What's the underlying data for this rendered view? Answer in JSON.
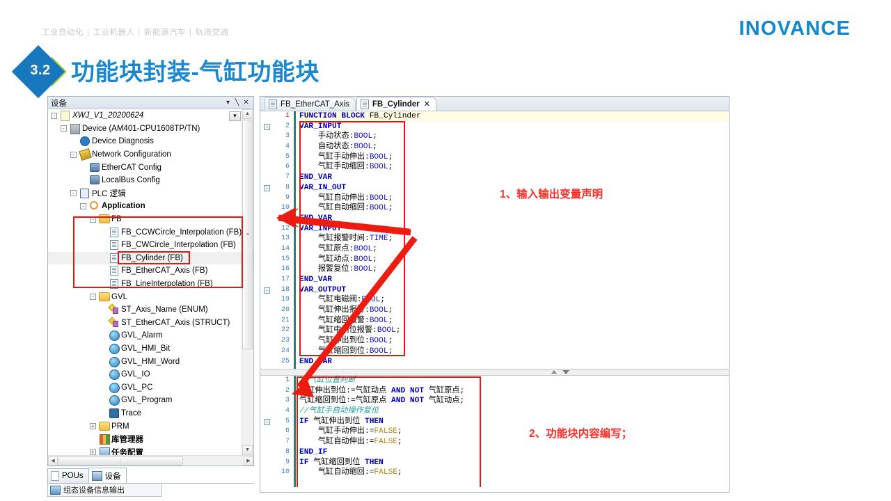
{
  "header": {
    "logo": "INOVANCE",
    "breadcrumb": [
      "工业自动化",
      "工业机器人",
      "新能源汽车",
      "轨道交通"
    ],
    "separator": "|"
  },
  "title": {
    "section_number": "3.2",
    "text": "功能块封装-气缸功能块"
  },
  "colors": {
    "brand_blue": "#1289CA",
    "title_blue": "#1B87CF",
    "diamond_blue": "#1878BE",
    "chevron_green": "#A5CE39",
    "annotation_red": "#ff2d26",
    "highlight_red": "#e8140f",
    "keyword_blue": "#0000C0",
    "comment_teal": "#1f9c9c",
    "literal_gold": "#b8860b"
  },
  "device_panel": {
    "title": "设备",
    "header_buttons": [
      "▾",
      "⇱",
      "✕"
    ],
    "dropdown_button": "▼",
    "tree": [
      {
        "indent": 1,
        "expander": "-",
        "icon": "project-icon",
        "label": "XWJ_V1_20200624",
        "style": "italic"
      },
      {
        "indent": 2,
        "expander": "-",
        "icon": "device-icon",
        "label": "Device (AM401-CPU1608TP/TN)",
        "style": "normal"
      },
      {
        "indent": 3,
        "expander": "",
        "icon": "diagnosis-icon",
        "label": "Device Diagnosis",
        "style": "normal"
      },
      {
        "indent": 3,
        "expander": "-",
        "icon": "network-icon",
        "label": "Network Configuration",
        "style": "normal"
      },
      {
        "indent": 4,
        "expander": "",
        "icon": "config-icon",
        "label": "EtherCAT Config",
        "style": "normal"
      },
      {
        "indent": 4,
        "expander": "",
        "icon": "config-icon",
        "label": "LocalBus Config",
        "style": "normal"
      },
      {
        "indent": 3,
        "expander": "-",
        "icon": "plc-icon",
        "label": "PLC 逻辑",
        "style": "normal"
      },
      {
        "indent": 4,
        "expander": "-",
        "icon": "application-icon",
        "label": "Application",
        "style": "bold"
      },
      {
        "indent": 5,
        "expander": "-",
        "icon": "folder-icon",
        "label": "FB",
        "style": "normal"
      },
      {
        "indent": 6,
        "expander": "",
        "icon": "fb-icon",
        "label": "FB_CCWCircle_Interpolation (FB)",
        "style": "normal"
      },
      {
        "indent": 6,
        "expander": "",
        "icon": "fb-icon",
        "label": "FB_CWCircle_Interpolation (FB)",
        "style": "normal"
      },
      {
        "indent": 6,
        "expander": "",
        "icon": "fb-icon",
        "label": "FB_Cylinder (FB)",
        "style": "normal",
        "selected": true
      },
      {
        "indent": 6,
        "expander": "",
        "icon": "fb-icon",
        "label": "FB_EtherCAT_Axis (FB)",
        "style": "normal"
      },
      {
        "indent": 6,
        "expander": "",
        "icon": "fb-icon",
        "label": "FB_LineInterpolation (FB)",
        "style": "normal"
      },
      {
        "indent": 5,
        "expander": "-",
        "icon": "folder-icon",
        "label": "GVL",
        "style": "normal"
      },
      {
        "indent": 6,
        "expander": "",
        "icon": "enum-icon",
        "label": "ST_Axis_Name (ENUM)",
        "style": "normal"
      },
      {
        "indent": 6,
        "expander": "",
        "icon": "enum-icon",
        "label": "ST_EtherCAT_Axis (STRUCT)",
        "style": "normal"
      },
      {
        "indent": 6,
        "expander": "",
        "icon": "gvl-icon",
        "label": "GVL_Alarm",
        "style": "normal"
      },
      {
        "indent": 6,
        "expander": "",
        "icon": "gvl-icon",
        "label": "GVL_HMI_Bit",
        "style": "normal"
      },
      {
        "indent": 6,
        "expander": "",
        "icon": "gvl-icon",
        "label": "GVL_HMI_Word",
        "style": "normal"
      },
      {
        "indent": 6,
        "expander": "",
        "icon": "gvl-icon",
        "label": "GVL_IO",
        "style": "normal"
      },
      {
        "indent": 6,
        "expander": "",
        "icon": "gvl-icon",
        "label": "GVL_PC",
        "style": "normal"
      },
      {
        "indent": 6,
        "expander": "",
        "icon": "gvl-icon",
        "label": "GVL_Program",
        "style": "normal"
      },
      {
        "indent": 6,
        "expander": "",
        "icon": "trace-icon",
        "label": "Trace",
        "style": "normal"
      },
      {
        "indent": 5,
        "expander": "+",
        "icon": "folder-icon",
        "label": "PRM",
        "style": "normal"
      },
      {
        "indent": 5,
        "expander": "",
        "icon": "library-icon",
        "label": "库管理器",
        "style": "bold"
      },
      {
        "indent": 5,
        "expander": "+",
        "icon": "task-icon",
        "label": "任务配置",
        "style": "bold"
      }
    ],
    "tabs": [
      {
        "label": "POUs",
        "icon": "pou-icon",
        "active": false
      },
      {
        "label": "设备",
        "icon": "device-tab-icon",
        "active": true
      }
    ],
    "footer_label": "组态设备信息输出"
  },
  "editor": {
    "tabs": [
      {
        "label": "FB_EtherCAT_Axis",
        "active": false,
        "closable": false
      },
      {
        "label": "FB_Cylinder",
        "active": true,
        "closable": true,
        "close_glyph": "✕"
      }
    ],
    "declaration": {
      "lines": [
        {
          "n": 1,
          "fold": "",
          "highlight": true,
          "tokens": [
            {
              "t": "FUNCTION BLOCK ",
              "c": "kw"
            },
            {
              "t": "FB_Cylinder",
              "c": ""
            }
          ]
        },
        {
          "n": 2,
          "fold": "-",
          "tokens": [
            {
              "t": "VAR_INPUT",
              "c": "kw"
            }
          ]
        },
        {
          "n": 3,
          "fold": "",
          "tokens": [
            {
              "t": "    手动状态:",
              "c": ""
            },
            {
              "t": "BOOL",
              "c": "ty"
            },
            {
              "t": ";",
              "c": ""
            }
          ]
        },
        {
          "n": 4,
          "fold": "",
          "tokens": [
            {
              "t": "    自动状态:",
              "c": ""
            },
            {
              "t": "BOOL",
              "c": "ty"
            },
            {
              "t": ";",
              "c": ""
            }
          ]
        },
        {
          "n": 5,
          "fold": "",
          "tokens": [
            {
              "t": "    气缸手动伸出:",
              "c": ""
            },
            {
              "t": "BOOL",
              "c": "ty"
            },
            {
              "t": ";",
              "c": ""
            }
          ]
        },
        {
          "n": 6,
          "fold": "",
          "tokens": [
            {
              "t": "    气缸手动缩回:",
              "c": ""
            },
            {
              "t": "BOOL",
              "c": "ty"
            },
            {
              "t": ";",
              "c": ""
            }
          ]
        },
        {
          "n": 7,
          "fold": "",
          "tokens": [
            {
              "t": "END_VAR",
              "c": "kw"
            }
          ]
        },
        {
          "n": 8,
          "fold": "-",
          "tokens": [
            {
              "t": "VAR_IN_OUT",
              "c": "kw"
            }
          ]
        },
        {
          "n": 9,
          "fold": "",
          "tokens": [
            {
              "t": "    气缸自动伸出:",
              "c": ""
            },
            {
              "t": "BOOL",
              "c": "ty"
            },
            {
              "t": ";",
              "c": ""
            }
          ]
        },
        {
          "n": 10,
          "fold": "",
          "tokens": [
            {
              "t": "    气缸自动缩回:",
              "c": ""
            },
            {
              "t": "BOOL",
              "c": "ty"
            },
            {
              "t": ";",
              "c": ""
            }
          ]
        },
        {
          "n": 11,
          "fold": "",
          "tokens": [
            {
              "t": "END_VAR",
              "c": "kw"
            }
          ]
        },
        {
          "n": 12,
          "fold": "",
          "tokens": [
            {
              "t": "VAR_INPUT",
              "c": "kw"
            }
          ]
        },
        {
          "n": 13,
          "fold": "",
          "tokens": [
            {
              "t": "    气缸报警时间:",
              "c": ""
            },
            {
              "t": "TIME",
              "c": "ty"
            },
            {
              "t": ";",
              "c": ""
            }
          ]
        },
        {
          "n": 14,
          "fold": "",
          "tokens": [
            {
              "t": "    气缸原点:",
              "c": ""
            },
            {
              "t": "BOOL",
              "c": "ty"
            },
            {
              "t": ";",
              "c": ""
            }
          ]
        },
        {
          "n": 15,
          "fold": "",
          "tokens": [
            {
              "t": "    气缸动点:",
              "c": ""
            },
            {
              "t": "BOOL",
              "c": "ty"
            },
            {
              "t": ";",
              "c": ""
            }
          ]
        },
        {
          "n": 16,
          "fold": "",
          "tokens": [
            {
              "t": "    报警复位:",
              "c": ""
            },
            {
              "t": "BOOL",
              "c": "ty"
            },
            {
              "t": ";",
              "c": ""
            }
          ]
        },
        {
          "n": 17,
          "fold": "",
          "tokens": [
            {
              "t": "END_VAR",
              "c": "kw"
            }
          ]
        },
        {
          "n": 18,
          "fold": "-",
          "tokens": [
            {
              "t": "VAR_OUTPUT",
              "c": "kw"
            }
          ]
        },
        {
          "n": 19,
          "fold": "",
          "tokens": [
            {
              "t": "    气缸电磁阀:",
              "c": ""
            },
            {
              "t": "BOOL",
              "c": "ty"
            },
            {
              "t": ";",
              "c": ""
            }
          ]
        },
        {
          "n": 20,
          "fold": "",
          "tokens": [
            {
              "t": "    气缸伸出报警:",
              "c": ""
            },
            {
              "t": "BOOL",
              "c": "ty"
            },
            {
              "t": ";",
              "c": ""
            }
          ]
        },
        {
          "n": 21,
          "fold": "",
          "tokens": [
            {
              "t": "    气缸缩回报警:",
              "c": ""
            },
            {
              "t": "BOOL",
              "c": "ty"
            },
            {
              "t": ";",
              "c": ""
            }
          ]
        },
        {
          "n": 22,
          "fold": "",
          "tokens": [
            {
              "t": "    气缸中间位报警:",
              "c": ""
            },
            {
              "t": "BOOL",
              "c": "ty"
            },
            {
              "t": ";",
              "c": ""
            }
          ]
        },
        {
          "n": 23,
          "fold": "",
          "tokens": [
            {
              "t": "    气缸伸出到位:",
              "c": ""
            },
            {
              "t": "BOOL",
              "c": "ty"
            },
            {
              "t": ";",
              "c": ""
            }
          ]
        },
        {
          "n": 24,
          "fold": "",
          "tokens": [
            {
              "t": "    气缸缩回到位:",
              "c": ""
            },
            {
              "t": "BOOL",
              "c": "ty"
            },
            {
              "t": ";",
              "c": ""
            }
          ]
        },
        {
          "n": 25,
          "fold": "",
          "tokens": [
            {
              "t": "END_VAR",
              "c": "kw"
            }
          ]
        }
      ]
    },
    "implementation": {
      "lines": [
        {
          "n": 1,
          "fold": "",
          "tokens": [
            {
              "t": "//气缸位置判断",
              "c": "cm"
            }
          ]
        },
        {
          "n": 2,
          "fold": "",
          "tokens": [
            {
              "t": "气缸伸出到位:=气缸动点 ",
              "c": ""
            },
            {
              "t": "AND NOT",
              "c": "kw"
            },
            {
              "t": " 气缸原点;",
              "c": ""
            }
          ]
        },
        {
          "n": 3,
          "fold": "",
          "tokens": [
            {
              "t": "气缸缩回到位:=气缸原点 ",
              "c": ""
            },
            {
              "t": "AND NOT",
              "c": "kw"
            },
            {
              "t": " 气缸动点;",
              "c": ""
            }
          ]
        },
        {
          "n": 4,
          "fold": "",
          "tokens": [
            {
              "t": "//气缸手自动操作复位",
              "c": "cm"
            }
          ]
        },
        {
          "n": 5,
          "fold": "-",
          "tokens": [
            {
              "t": "IF",
              "c": "kw"
            },
            {
              "t": " 气缸伸出到位 ",
              "c": ""
            },
            {
              "t": "THEN",
              "c": "kw"
            }
          ]
        },
        {
          "n": 6,
          "fold": "",
          "tokens": [
            {
              "t": "    气缸手动伸出:=",
              "c": ""
            },
            {
              "t": "FALSE",
              "c": "fal"
            },
            {
              "t": ";",
              "c": ""
            }
          ]
        },
        {
          "n": 7,
          "fold": "",
          "tokens": [
            {
              "t": "    气缸自动伸出:=",
              "c": ""
            },
            {
              "t": "FALSE",
              "c": "fal"
            },
            {
              "t": ";",
              "c": ""
            }
          ]
        },
        {
          "n": 8,
          "fold": "",
          "tokens": [
            {
              "t": "END_IF",
              "c": "kw"
            }
          ]
        },
        {
          "n": 9,
          "fold": "",
          "tokens": [
            {
              "t": "IF",
              "c": "kw"
            },
            {
              "t": " 气缸缩回到位 ",
              "c": ""
            },
            {
              "t": "THEN",
              "c": "kw"
            }
          ]
        },
        {
          "n": 10,
          "fold": "",
          "tokens": [
            {
              "t": "    气缸自动缩回:=",
              "c": ""
            },
            {
              "t": "FALSE",
              "c": "fal"
            },
            {
              "t": ";",
              "c": ""
            }
          ]
        }
      ]
    },
    "splitter_arrows": [
      "▲",
      "▼"
    ]
  },
  "annotations": [
    {
      "id": "anno-1",
      "text": "1、输入输出变量声明"
    },
    {
      "id": "anno-2",
      "text": "2、功能块内容编写；"
    }
  ]
}
